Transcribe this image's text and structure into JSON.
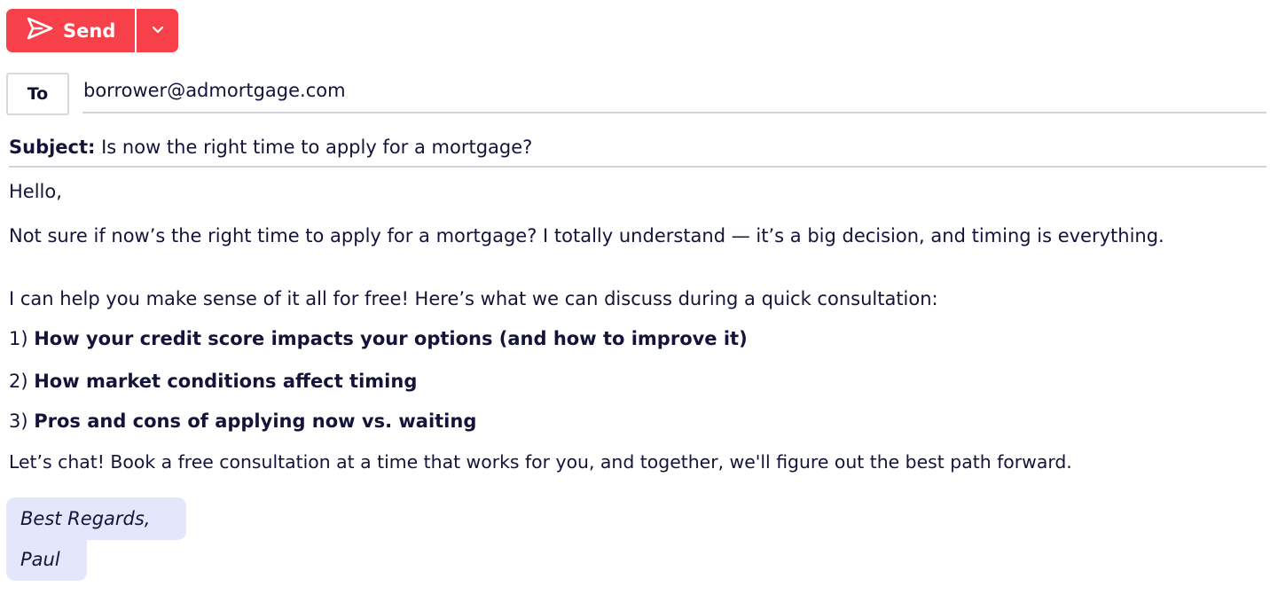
{
  "toolbar": {
    "send_label": "Send",
    "send_icon": "send-icon",
    "dropdown_icon": "chevron-down-icon",
    "accent_color": "#f7404a"
  },
  "recipient": {
    "to_label": "To",
    "to_value": "borrower@admortgage.com"
  },
  "subject": {
    "label": "Subject:",
    "value": " Is now the right time to apply for a mortgage?"
  },
  "body": {
    "greeting": "Hello,",
    "paragraph1": "Not sure if now’s the right time to apply for a mortgage? I totally understand — it’s a big decision, and timing is everything.",
    "paragraph2": "I can help you make sense of it all for free! Here’s what we can discuss during a quick consultation:",
    "items": [
      {
        "number": "1) ",
        "text": "How your credit score impacts your options (and how to improve it)"
      },
      {
        "number": "2) ",
        "text": "How market conditions affect timing"
      },
      {
        "number": "3) ",
        "text": "Pros and cons of applying now vs. waiting"
      }
    ],
    "closing": "Let’s chat! Book a free consultation at a time that works for you, and together, we'll figure out the best path forward."
  },
  "signature": {
    "line1": "Best Regards,",
    "line2": "Paul",
    "background_color": "#e4e6fb"
  }
}
